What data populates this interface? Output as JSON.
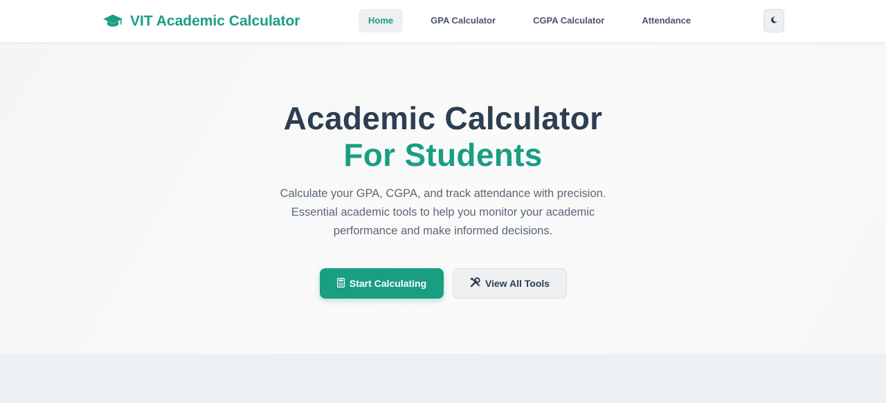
{
  "brand": {
    "name": "VIT Academic Calculator",
    "icon": "graduation-cap-icon",
    "color": "#1a9e82"
  },
  "nav": {
    "items": [
      {
        "label": "Home",
        "active": true
      },
      {
        "label": "GPA Calculator",
        "active": false
      },
      {
        "label": "CGPA Calculator",
        "active": false
      },
      {
        "label": "Attendance",
        "active": false
      }
    ],
    "theme_toggle_icon": "moon-icon"
  },
  "hero": {
    "title_line1": "Academic Calculator",
    "title_line2": "For Students",
    "subtitle": "Calculate your GPA, CGPA, and track attendance with precision. Essential academic tools to help you monitor your academic performance and make informed decisions.",
    "primary_button": {
      "label": "Start Calculating",
      "icon": "calculator-icon"
    },
    "secondary_button": {
      "label": "View All Tools",
      "icon": "tools-icon"
    }
  },
  "colors": {
    "accent": "#1a9e82",
    "heading": "#2c3e50",
    "body_text": "#5b6675"
  }
}
